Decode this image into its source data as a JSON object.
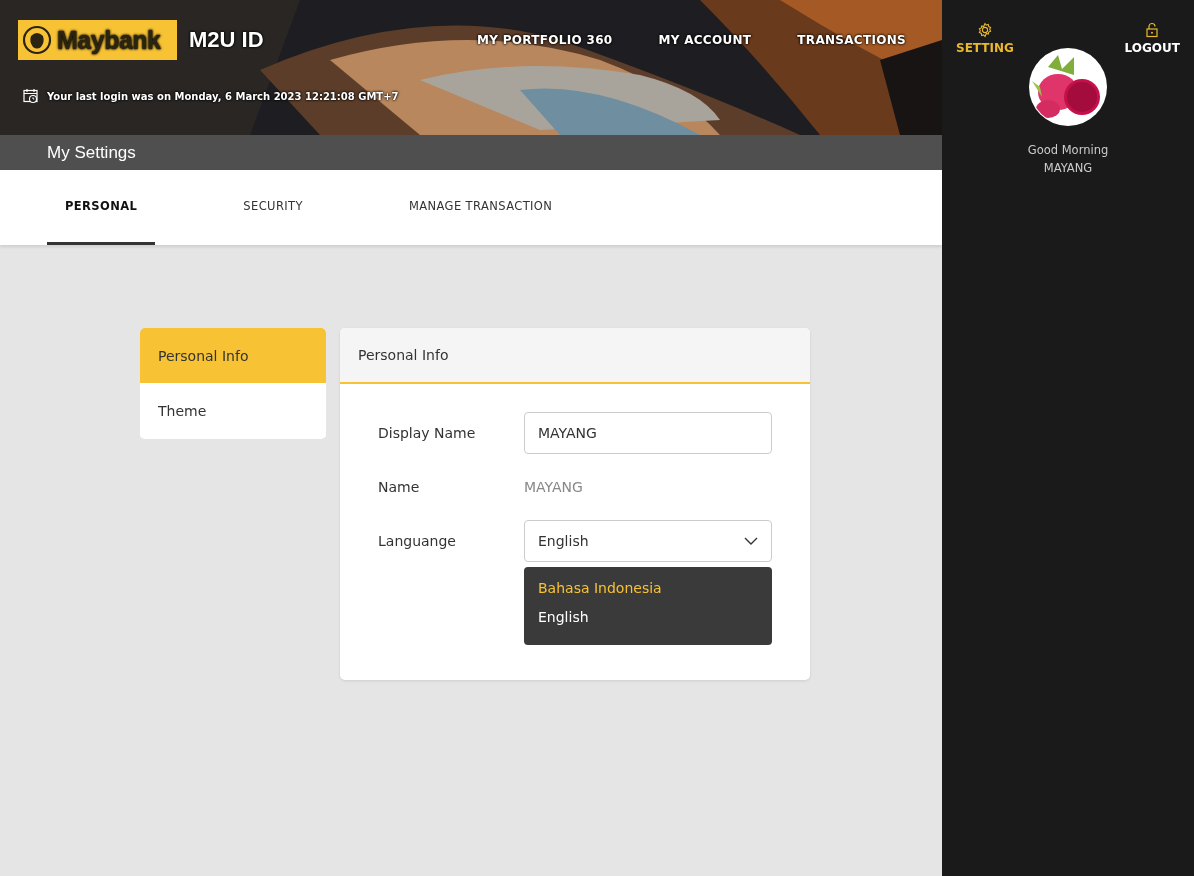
{
  "header": {
    "logo_text": "Maybank",
    "app_title": "M2U ID",
    "last_login": "Your last login was on Monday, 6 March 2023 12:21:08 GMT+7",
    "nav": [
      {
        "label": "MY PORTFOLIO 360"
      },
      {
        "label": "MY ACCOUNT"
      },
      {
        "label": "TRANSACTIONS"
      }
    ]
  },
  "sidebar": {
    "actions": [
      {
        "kind": "setting",
        "label": "SETTING",
        "selected": true
      },
      {
        "kind": "logout",
        "label": "LOGOUT",
        "selected": false
      }
    ],
    "greeting": "Good Morning",
    "user": "MAYANG"
  },
  "page_title": "My Settings",
  "tabs": [
    {
      "label": "PERSONAL",
      "selected": true
    },
    {
      "label": "SECURITY",
      "selected": false
    },
    {
      "label": "MANAGE TRANSACTION",
      "selected": false
    }
  ],
  "side_menu": [
    {
      "label": "Personal Info",
      "selected": true
    },
    {
      "label": "Theme",
      "selected": false
    }
  ],
  "panel": {
    "title": "Personal Info",
    "fields": [
      {
        "kind": "input",
        "label": "Display Name",
        "value": "MAYANG"
      },
      {
        "kind": "text",
        "label": "Name",
        "value": "MAYANG"
      },
      {
        "kind": "select",
        "label": "Languange",
        "value": "English",
        "expanded": true,
        "options": [
          {
            "label": "Bahasa Indonesia",
            "highlighted": true
          },
          {
            "label": "English",
            "highlighted": false
          }
        ]
      }
    ]
  }
}
